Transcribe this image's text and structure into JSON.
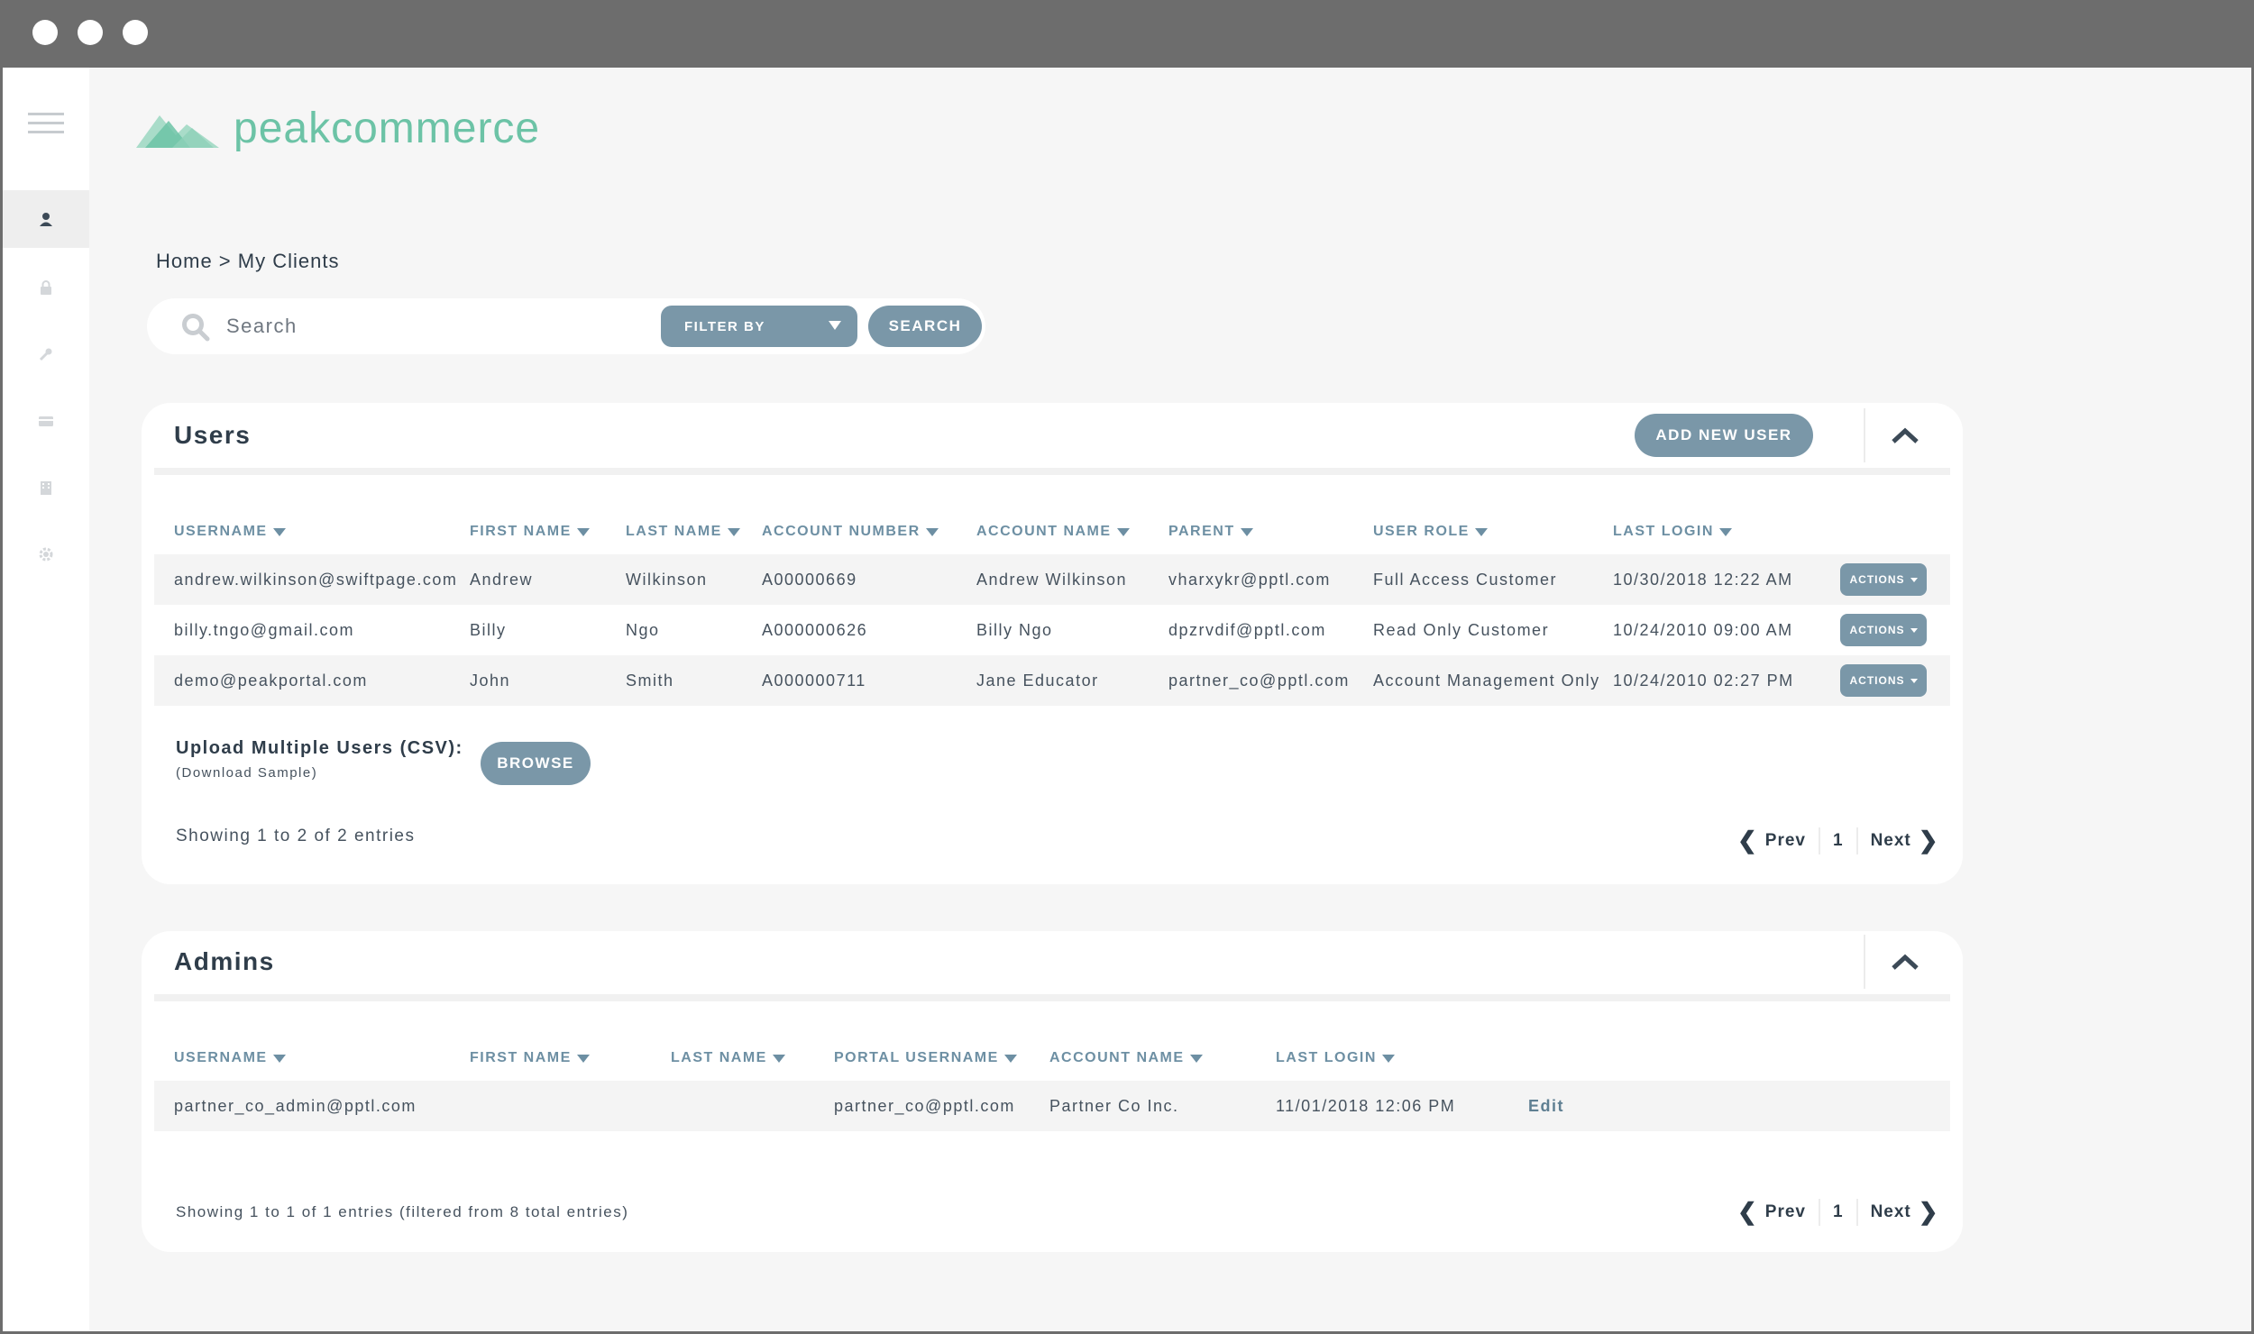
{
  "window": {
    "controls": [
      "close",
      "minimize",
      "maximize"
    ]
  },
  "sidebar": {
    "items": [
      {
        "icon": "user-icon",
        "active": true
      },
      {
        "icon": "lock-icon",
        "active": false
      },
      {
        "icon": "wrench-icon",
        "active": false
      },
      {
        "icon": "card-icon",
        "active": false
      },
      {
        "icon": "building-icon",
        "active": false
      },
      {
        "icon": "gear-icon",
        "active": false
      }
    ]
  },
  "brand": {
    "name": "peakcommerce",
    "color": "#6cc3a6"
  },
  "breadcrumb": "Home > My Clients",
  "search": {
    "placeholder": "Search",
    "filter_label": "FILTER BY",
    "button_label": "SEARCH"
  },
  "users": {
    "title": "Users",
    "add_button": "ADD NEW USER",
    "columns": [
      "USERNAME",
      "FIRST NAME",
      "LAST NAME",
      "ACCOUNT NUMBER",
      "ACCOUNT NAME",
      "PARENT",
      "USER ROLE",
      "LAST LOGIN"
    ],
    "rows": [
      {
        "username": "andrew.wilkinson@swiftpage.com",
        "first": "Andrew",
        "last": "Wilkinson",
        "account_number": "A00000669",
        "account_name": "Andrew Wilkinson",
        "parent": "vharxykr@pptl.com",
        "role": "Full Access Customer",
        "last_login": "10/30/2018 12:22 AM",
        "action": "ACTIONS"
      },
      {
        "username": "billy.tngo@gmail.com",
        "first": "Billy",
        "last": "Ngo",
        "account_number": "A000000626",
        "account_name": "Billy Ngo",
        "parent": "dpzrvdif@pptl.com",
        "role": "Read Only Customer",
        "last_login": "10/24/2010 09:00 AM",
        "action": "ACTIONS"
      },
      {
        "username": "demo@peakportal.com",
        "first": "John",
        "last": "Smith",
        "account_number": "A000000711",
        "account_name": "Jane Educator",
        "parent": "partner_co@pptl.com",
        "role": "Account Management Only",
        "last_login": "10/24/2010 02:27 PM",
        "action": "ACTIONS"
      }
    ],
    "upload_label": "Upload Multiple Users (CSV):",
    "upload_sample": "(Download Sample)",
    "browse_label": "BROWSE",
    "showing": "Showing 1 to 2 of 2 entries",
    "pager": {
      "prev": "Prev",
      "page": "1",
      "next": "Next"
    }
  },
  "admins": {
    "title": "Admins",
    "columns": [
      "USERNAME",
      "FIRST NAME",
      "LAST NAME",
      "PORTAL USERNAME",
      "ACCOUNT NAME",
      "LAST LOGIN"
    ],
    "rows": [
      {
        "username": "partner_co_admin@pptl.com",
        "first": "",
        "last": "",
        "portal_username": "partner_co@pptl.com",
        "account_name": "Partner Co Inc.",
        "last_login": "11/01/2018 12:06 PM",
        "action": "Edit"
      }
    ],
    "showing": "Showing 1 to 1 of 1 entries (filtered from 8 total entries)",
    "pager": {
      "prev": "Prev",
      "page": "1",
      "next": "Next"
    }
  }
}
